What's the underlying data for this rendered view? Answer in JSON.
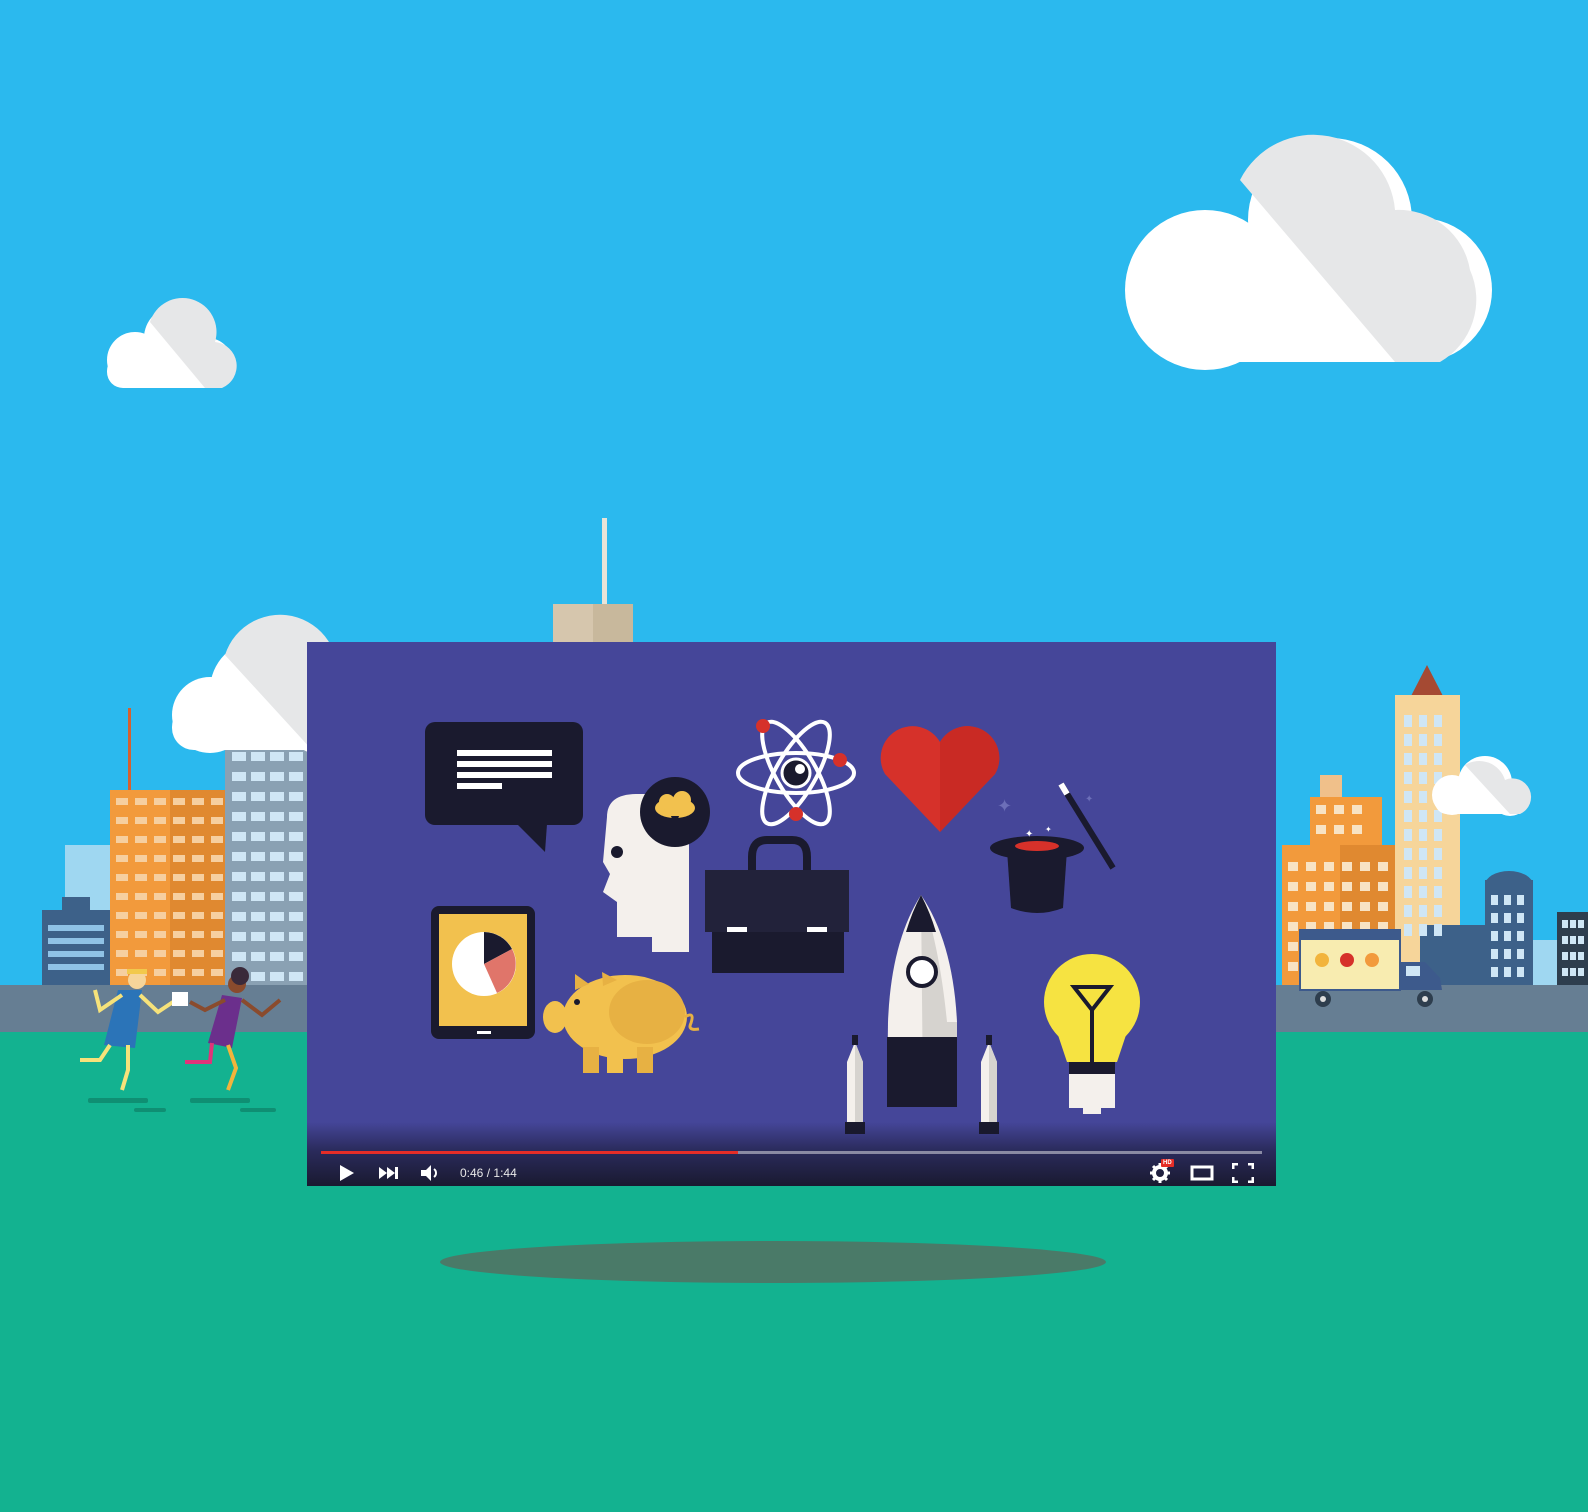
{
  "player": {
    "current_time": "0:46",
    "separator": "/",
    "duration": "1:44",
    "progress_fraction": 0.443,
    "hd_badge": "HD",
    "colors": {
      "progress": "#e52d27",
      "player_bg": "#454699"
    }
  },
  "controls": [
    {
      "name": "play-button",
      "icon": "play-icon"
    },
    {
      "name": "next-button",
      "icon": "next-icon"
    },
    {
      "name": "volume-button",
      "icon": "volume-icon"
    },
    {
      "name": "settings-button",
      "icon": "gear-icon"
    },
    {
      "name": "theater-mode-button",
      "icon": "theater-icon"
    },
    {
      "name": "fullscreen-button",
      "icon": "fullscreen-icon"
    }
  ],
  "scene_colors": {
    "sky": "#2bb9ee",
    "grass": "#13b290",
    "road": "#667e93",
    "cloud": "#ffffff",
    "cloud_shade": "#e6e7e8"
  }
}
